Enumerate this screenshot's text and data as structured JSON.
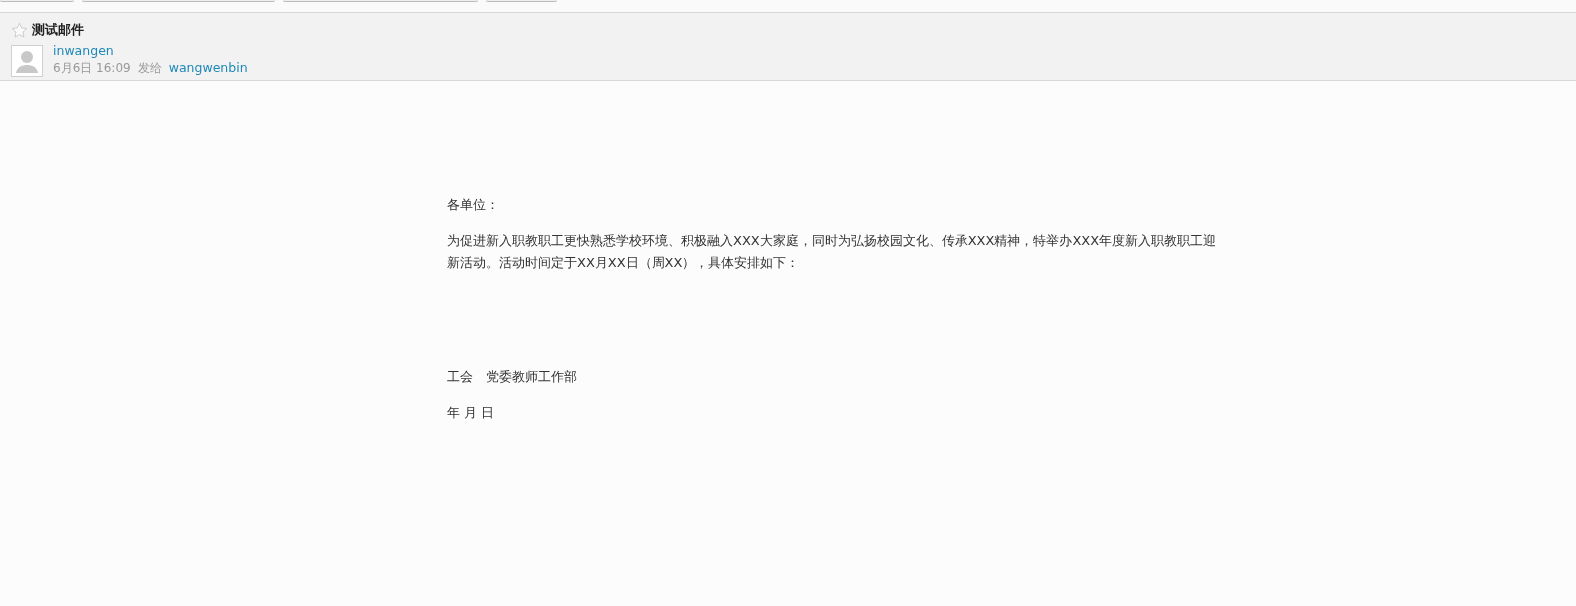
{
  "mail": {
    "subject": "测试邮件",
    "starred": false,
    "sender": "inwangen",
    "date": "6月6日 16:09",
    "sent_to_label": "发给",
    "recipient": "wangwenbin"
  },
  "body": {
    "greeting": "各单位：",
    "paragraphs": [
      "为促进新入职教职工更快熟悉学校环境、积极融入XXX大家庭，同时为弘扬校园文化、传承XXX精神，特举办XXX年度新入职教职工迎新活动。活动时间定于XX月XX日（周XX），具体安排如下："
    ],
    "signature": "工会　党委教师工作部",
    "date": "年 月 日"
  }
}
